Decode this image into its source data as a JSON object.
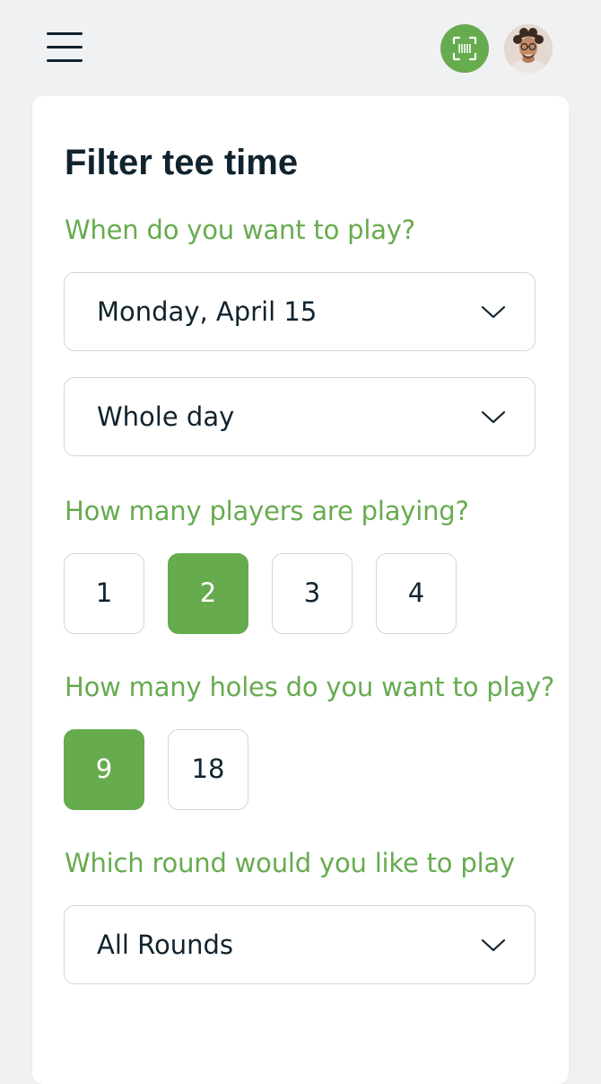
{
  "header": {
    "menu_icon": "hamburger-menu-icon",
    "scan_icon": "barcode-scan-icon",
    "avatar": "user-avatar"
  },
  "colors": {
    "accent": "#67ab4f",
    "text": "#10232e",
    "border": "#d3d6d8",
    "background": "#f0f1f3",
    "card": "#ffffff"
  },
  "filter": {
    "title": "Filter tee time",
    "when_question": "When do you want to play?",
    "date_value": "Monday, April 15",
    "time_value": "Whole day",
    "players_question": "How many players are playing?",
    "players_options": [
      "1",
      "2",
      "3",
      "4"
    ],
    "players_selected": "2",
    "holes_question": "How many holes do you want to play?",
    "holes_options": [
      "9",
      "18"
    ],
    "holes_selected": "9",
    "round_question": "Which round would you like to play",
    "round_value": "All Rounds"
  }
}
